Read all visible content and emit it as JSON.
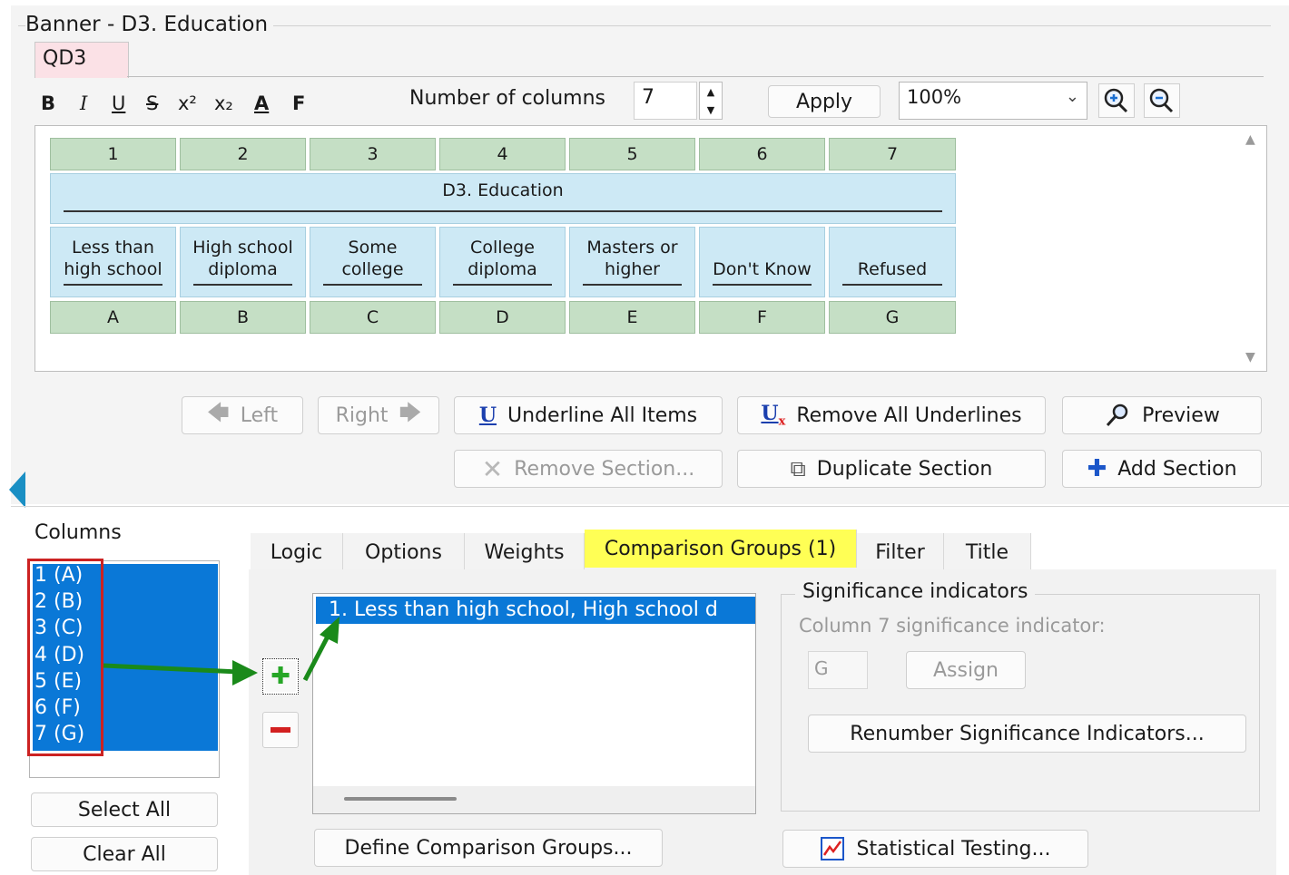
{
  "banner": {
    "title": "Banner - D3.  Education",
    "tab": "QD3"
  },
  "format_toolbar": {
    "bold": "B",
    "italic": "I",
    "underline": "U",
    "strike": "S",
    "superscript": "x²",
    "subscript": "x₂",
    "color": "A",
    "font": "F"
  },
  "columns_control": {
    "label": "Number of columns",
    "value": "7",
    "apply": "Apply",
    "zoom": "100%"
  },
  "grid": {
    "numbers": [
      "1",
      "2",
      "3",
      "4",
      "5",
      "6",
      "7"
    ],
    "header": "D3.  Education",
    "labels": [
      [
        "Less than",
        "high school"
      ],
      [
        "High school",
        "diploma"
      ],
      [
        "Some",
        "college"
      ],
      [
        "College",
        "diploma"
      ],
      [
        "Masters or",
        "higher"
      ],
      [
        "",
        "Don't Know"
      ],
      [
        "",
        "Refused"
      ]
    ],
    "letters": [
      "A",
      "B",
      "C",
      "D",
      "E",
      "F",
      "G"
    ]
  },
  "actions": {
    "left": "Left",
    "right": "Right",
    "underline_all": "Underline All Items",
    "remove_underlines": "Remove All Underlines",
    "preview": "Preview",
    "remove_section": "Remove Section...",
    "duplicate_section": "Duplicate Section",
    "add_section": "Add Section"
  },
  "columns_panel": {
    "title": "Columns",
    "items": [
      "1 (A)",
      "2 (B)",
      "3 (C)",
      "4 (D)",
      "5 (E)",
      "6 (F)",
      "7 (G)"
    ],
    "select_all": "Select All",
    "clear_all": "Clear All"
  },
  "tabs": [
    "Logic",
    "Options",
    "Weights",
    "Comparison Groups (1)",
    "Filter",
    "Title"
  ],
  "comparison": {
    "groups": [
      "1. Less than high school, High school d"
    ],
    "define": "Define Comparison Groups..."
  },
  "significance": {
    "title": "Significance indicators",
    "column_label": "Column 7 significance indicator:",
    "indicator_value": "G",
    "assign": "Assign",
    "renumber": "Renumber Significance Indicators...",
    "stat_testing": "Statistical Testing..."
  },
  "colors": {
    "selection": "#0a78d7",
    "highlight_tab": "#ffff55",
    "grid_green": "#c5dfc5",
    "grid_blue": "#cde9f5",
    "annotation_red": "#cc2222",
    "annotation_arrow": "#1a8a1a"
  }
}
